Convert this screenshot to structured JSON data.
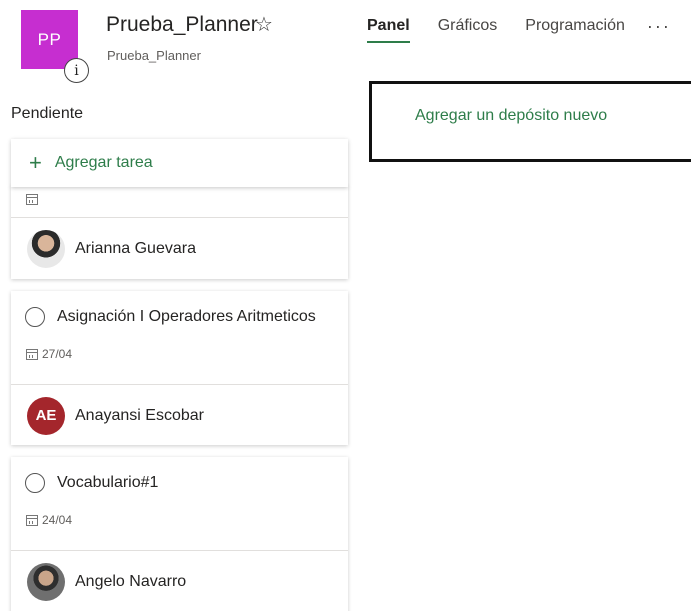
{
  "header": {
    "avatar_initials": "PP",
    "info_label": "i",
    "title": "Prueba_Planner",
    "star_icon": "☆",
    "subtitle": "Prueba_Planner",
    "tabs": [
      {
        "label": "Panel",
        "active": true
      },
      {
        "label": "Gráficos",
        "active": false
      },
      {
        "label": "Programación",
        "active": false
      }
    ],
    "more_icon": "···"
  },
  "bucket": {
    "title": "Pendiente",
    "add_task_label": "Agregar tarea",
    "add_icon": "+",
    "cards": [
      {
        "title": "",
        "date": "",
        "assignee": "Arianna Guevara",
        "assignee_initials": "",
        "avatar_color": "#3b3b3b"
      },
      {
        "title": "Asignación I Operadores Aritmeticos",
        "date": "27/04",
        "assignee": "Anayansi Escobar",
        "assignee_initials": "AE",
        "avatar_color": "#a4262c"
      },
      {
        "title": "Vocabulario#1",
        "date": "24/04",
        "assignee": "Angelo Navarro",
        "assignee_initials": "",
        "avatar_color": "#4a4a4a"
      }
    ]
  },
  "new_bucket": {
    "label": "Agregar un depósito nuevo"
  },
  "colors": {
    "accent": "#2e7d4a",
    "plan_avatar": "#c62ed0"
  }
}
